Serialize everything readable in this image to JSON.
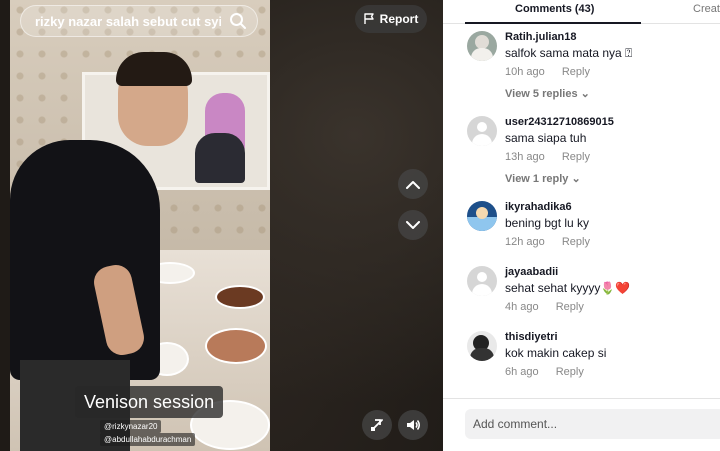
{
  "video": {
    "search_text": "rizky nazar salah sebut cut syif...",
    "report_label": "Report",
    "caption": "Venison session",
    "tag_1": "@rizkynazar20",
    "tag_2": "@abdullahabdurachman"
  },
  "comments_panel": {
    "tab_comments": "Comments (43)",
    "tab_creator": "Creat",
    "comments": [
      {
        "user": "Ratih.julian18",
        "text": "salfok sama mata nya ⍰",
        "time": "10h ago",
        "reply": "Reply",
        "view_replies": "View 5 replies ⌄"
      },
      {
        "user": "user24312710869015",
        "text": "sama siapa tuh",
        "time": "13h ago",
        "reply": "Reply",
        "view_replies": "View 1 reply ⌄"
      },
      {
        "user": "ikyrahadika6",
        "text": "bening bgt lu ky",
        "time": "12h ago",
        "reply": "Reply"
      },
      {
        "user": "jayaabadii",
        "text": "sehat sehat kyyyy🌷❤️",
        "time": "4h ago",
        "reply": "Reply"
      },
      {
        "user": "thisdiyetri",
        "text": "kok makin cakep si",
        "time": "6h ago",
        "reply": "Reply"
      }
    ],
    "add_comment_placeholder": "Add comment..."
  },
  "colors": {
    "accent_text": "#161823",
    "muted_text": "#888888",
    "panel_bg": "#ffffff",
    "video_bg": "#1a1613"
  },
  "icons": [
    "search-icon",
    "flag-icon",
    "chevron-up-icon",
    "chevron-down-icon",
    "pip-icon",
    "volume-icon"
  ]
}
